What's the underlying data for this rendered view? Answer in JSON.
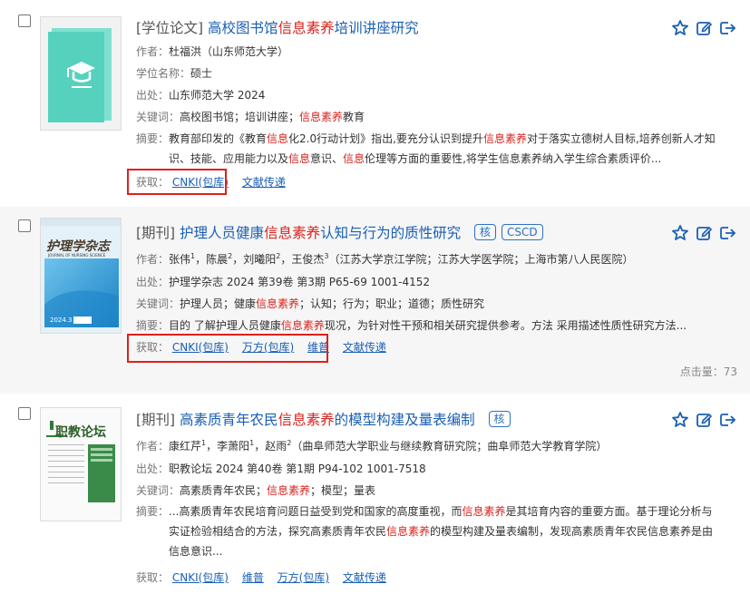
{
  "results": [
    {
      "type": "[学位论文]",
      "title_pre": "高校图书馆",
      "title_hl": "信息素养",
      "title_post": "培训讲座研究",
      "author_label": "作者：",
      "authors": "杜福洪（山东师范大学）",
      "degree_label": "学位名称：",
      "degree": "硕士",
      "source_label": "出处：",
      "source": "山东师范大学 2024",
      "keywords_label": "关键词：",
      "kw_a": "高校图书馆；培训讲座；",
      "kw_hl": "信息素养",
      "kw_b": "教育",
      "abstract_label": "摘要：",
      "abs_1": "教育部印发的《教育",
      "abs_hl1": "信息",
      "abs_2": "化2.0行动计划》指出,要充分认识到提升",
      "abs_hl2": "信息素养",
      "abs_3": "对于落实立德树人目标,培养创新人才知识、技能、应用能力以及",
      "abs_hl3": "信息",
      "abs_4": "意识、",
      "abs_hl4": "信息",
      "abs_5": "伦理等方面的重要性,将学生信息素养纳入学生综合素质评价...",
      "access_label": "获取：",
      "links": [
        "CNKI(包库)",
        "文献传递"
      ]
    },
    {
      "type": "[期刊]",
      "title_pre": "护理人员健康",
      "title_hl": "信息素养",
      "title_post": "认知与行为的质性研究",
      "badges": [
        "核",
        "CSCD"
      ],
      "author_label": "作者：",
      "a1": "张伟",
      "a1_sup": "1",
      "a2": "，陈晨",
      "a2_sup": "2",
      "a3": "，刘曦阳",
      "a3_sup": "2",
      "a4": "，王俊杰",
      "a4_sup": "3",
      "a_aff": "（江苏大学京江学院；江苏大学医学院；上海市第八人民医院）",
      "source_label": "出处：",
      "source": "护理学杂志 2024 第39卷 第3期 P65-69  1001-4152",
      "keywords_label": "关键词：",
      "kw_a": "护理人员；健康",
      "kw_hl": "信息素养",
      "kw_b": "；认知；行为；职业；道德；质性研究",
      "abstract_label": "摘要：",
      "abs_1": "目的 了解护理人员健康",
      "abs_hl1": "信息素养",
      "abs_2": "现况，为针对性干预和相关研究提供参考。方法 采用描述性质性研究方法...",
      "access_label": "获取：",
      "links": [
        "CNKI(包库)",
        "万方(包库)",
        "维普",
        "文献传递"
      ],
      "clicks": "点击量：73",
      "cover_title": "护理学杂志",
      "cover_sub": "JOURNAL OF NURSING SCIENCE",
      "cover_year": "2024.3"
    },
    {
      "type": "[期刊]",
      "title_pre": "高素质青年农民",
      "title_hl": "信息素养",
      "title_post": "的模型构建及量表编制",
      "badges": [
        "核"
      ],
      "author_label": "作者：",
      "a1": "康红芹",
      "a1_sup": "1",
      "a2": "，李萧阳",
      "a2_sup": "1",
      "a3": "，赵雨",
      "a3_sup": "2",
      "a_aff": "（曲阜师范大学职业与继续教育研究院；曲阜师范大学教育学院）",
      "source_label": "出处：",
      "source": "职教论坛 2024 第40卷 第1期 P94-102  1001-7518",
      "keywords_label": "关键词：",
      "kw_a": "高素质青年农民；",
      "kw_hl": "信息素养",
      "kw_b": "；模型；量表",
      "abstract_label": "摘要：",
      "abs_1": "...高素质青年农民培育问题日益受到党和国家的高度重视，而",
      "abs_hl1": "信息素养",
      "abs_2": "是其培育内容的重要方面。基于理论分析与实证检验相结合的方法，探究高素质青年农民",
      "abs_hl2": "信息素养",
      "abs_3": "的模型构建及量表编制，发现高素质青年农民信息素养是由信息意识...",
      "access_label": "获取：",
      "links": [
        "CNKI(包库)",
        "维普",
        "万方(包库)",
        "文献传递"
      ],
      "cover_title": "职教论坛"
    }
  ],
  "icons": [
    "star-icon",
    "edit-icon",
    "export-icon"
  ],
  "colors": {
    "link": "#1a5fb4",
    "highlight": "#d6241f",
    "annotation": "#e0201b"
  }
}
